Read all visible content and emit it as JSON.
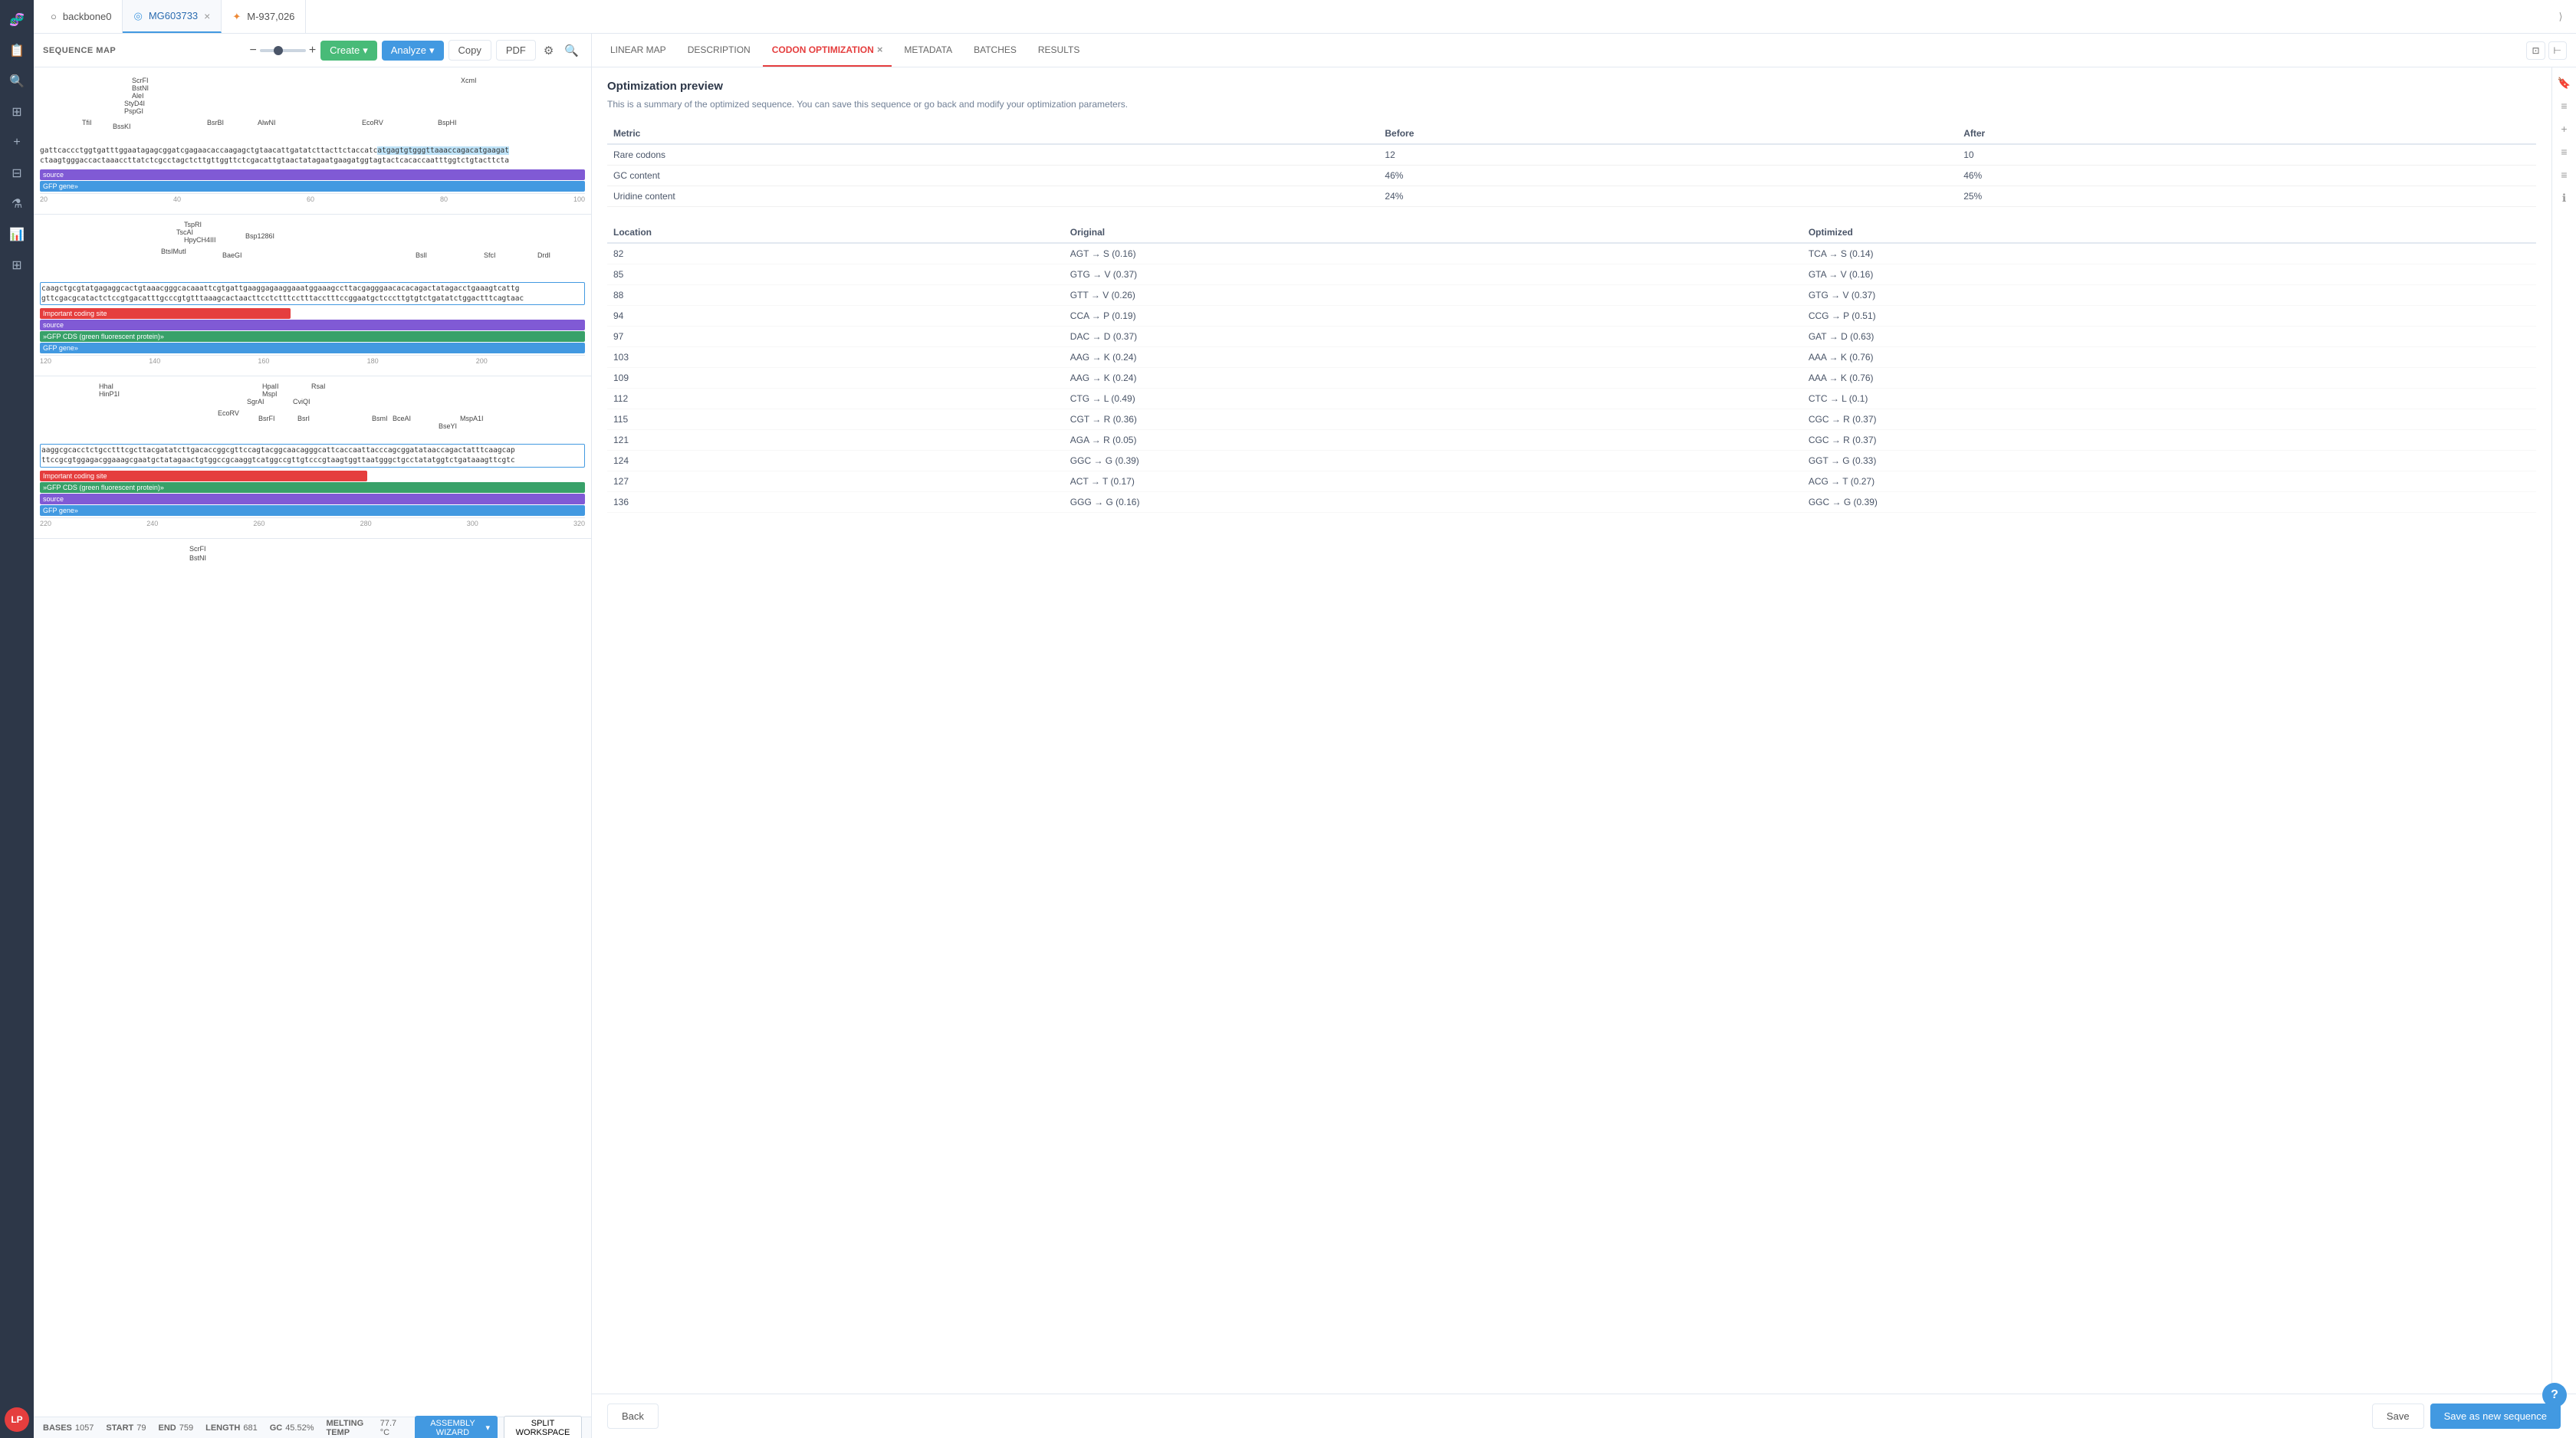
{
  "sidebar": {
    "icons": [
      {
        "name": "dna-icon",
        "symbol": "🧬",
        "active": false
      },
      {
        "name": "file-icon",
        "symbol": "📄",
        "active": false
      },
      {
        "name": "search-icon",
        "symbol": "🔍",
        "active": false
      },
      {
        "name": "layers-icon",
        "symbol": "⊞",
        "active": false
      },
      {
        "name": "plus-icon",
        "symbol": "+",
        "active": false
      },
      {
        "name": "table-icon",
        "symbol": "⊟",
        "active": false
      },
      {
        "name": "flask-icon",
        "symbol": "⚗",
        "active": false
      },
      {
        "name": "chart-icon",
        "symbol": "📊",
        "active": false
      },
      {
        "name": "grid-icon",
        "symbol": "⊞",
        "active": false
      }
    ],
    "avatar": "LP"
  },
  "tabs": [
    {
      "id": "backbone0",
      "label": "backbone0",
      "icon": "○",
      "active": false,
      "closeable": false
    },
    {
      "id": "MG603733",
      "label": "MG603733",
      "icon": "◎",
      "active": true,
      "closeable": true
    },
    {
      "id": "M-937026",
      "label": "M-937,026",
      "icon": "✦",
      "active": false,
      "closeable": false
    }
  ],
  "sequence_map": {
    "title": "SEQUENCE MAP",
    "toolbar": {
      "create_label": "Create",
      "analyze_label": "Analyze",
      "copy_label": "Copy",
      "pdf_label": "PDF"
    },
    "blocks": [
      {
        "id": "block1",
        "restriction_sites": [
          {
            "label": "ScrFI",
            "x": 13
          },
          {
            "label": "BstNI",
            "x": 13
          },
          {
            "label": "AleI",
            "x": 13
          },
          {
            "label": "StyD4I",
            "x": 13
          },
          {
            "label": "PspGI",
            "x": 13
          },
          {
            "label": "TfiI",
            "x": 0
          },
          {
            "label": "BssKI",
            "x": 10
          },
          {
            "label": "BsrBI",
            "x": 22
          },
          {
            "label": "AlwNI",
            "x": 29
          },
          {
            "label": "EcoRV",
            "x": 43
          },
          {
            "label": "BspHI",
            "x": 53
          },
          {
            "label": "XcmI",
            "x": 55
          }
        ],
        "seq1": "gattcaccctggtgatttggaatagagcggatcgagaacaccaagagctgtaacattgatatcttacttctaccatcatgagtgtgggttaaaccagacatgaagat",
        "seq2": "ctaagtgggaccactaaaccttatctcgcctagctcttgttggttctcgacattgtaactatagaatgaagatggtagtactcacaccaatttggtctgtacttcta",
        "features": [
          {
            "label": "source",
            "type": "source",
            "width": "100%"
          },
          {
            "label": "GFP gene",
            "type": "gfp",
            "width": "100%"
          }
        ],
        "ruler": [
          "20",
          "40",
          "60",
          "80",
          "100"
        ]
      },
      {
        "id": "block2",
        "restriction_sites": [
          {
            "label": "TspRI",
            "x": 19
          },
          {
            "label": "TscAI",
            "x": 18
          },
          {
            "label": "HpyCH4III",
            "x": 19
          },
          {
            "label": "Bsp1286I",
            "x": 27
          },
          {
            "label": "BtsIMutI",
            "x": 16
          },
          {
            "label": "BaeGI",
            "x": 24
          },
          {
            "label": "BslI",
            "x": 49
          },
          {
            "label": "SfcI",
            "x": 59
          },
          {
            "label": "DrdI",
            "x": 66
          }
        ],
        "seq1": "caagctgcgtatgagaggcactgtaaacgggcacaaattcgtgattgaaggagaaggaaatggaaagccttacgagggaacacacagactatagacctgaaagtcattg",
        "seq2": "gttcgacgcatactctccgtgacatttgcccgtgtttaaagcactaacttcctctttcctttacctttccggaatgctcccttgtgtctgatatctggactttcagtaac",
        "features": [
          {
            "label": "Important coding site",
            "type": "coding",
            "width": "45%"
          },
          {
            "label": "source",
            "type": "source",
            "width": "100%"
          },
          {
            "label": "GFP CDS (green fluorescent protein)",
            "type": "cds",
            "width": "100%"
          },
          {
            "label": "GFP gene",
            "type": "gfp",
            "width": "100%"
          }
        ],
        "ruler": [
          "120",
          "140",
          "160",
          "180",
          "200",
          ""
        ]
      },
      {
        "id": "block3",
        "restriction_sites": [
          {
            "label": "HhaI",
            "x": 8
          },
          {
            "label": "HinP1I",
            "x": 8
          },
          {
            "label": "HpaII",
            "x": 30
          },
          {
            "label": "MspI",
            "x": 30
          },
          {
            "label": "RsaI",
            "x": 36
          },
          {
            "label": "SgrAI",
            "x": 28
          },
          {
            "label": "CviQI",
            "x": 34
          },
          {
            "label": "EcoRV",
            "x": 24
          },
          {
            "label": "BsrFI",
            "x": 30
          },
          {
            "label": "BsrI",
            "x": 34
          },
          {
            "label": "BsmI",
            "x": 44
          },
          {
            "label": "BceAI",
            "x": 47
          },
          {
            "label": "MspA1I",
            "x": 56
          },
          {
            "label": "BseYI",
            "x": 53
          }
        ],
        "seq1": "aaggcgcacctctgcctttcgcttacgatatcttgacaccggcgttccagtacggcaacagggcattcaccaattacccagcggatataaccagactatttcaagcap",
        "seq2": "ttccgcgtggagacggaaagcgaatgctatagaactgtggccgcaaggtcatggccgttgtcccgtaagtggttaatgggctgcctatatggtctgataaagttcgtc",
        "features": [
          {
            "label": "Important coding site",
            "type": "coding",
            "width": "60%"
          },
          {
            "label": "GFP CDS (green fluorescent protein)",
            "type": "cds",
            "width": "100%"
          },
          {
            "label": "source",
            "type": "source",
            "width": "100%"
          },
          {
            "label": "GFP gene",
            "type": "gfp",
            "width": "100%"
          }
        ],
        "ruler": [
          "220",
          "240",
          "260",
          "280",
          "300",
          "320"
        ]
      }
    ]
  },
  "right_panel": {
    "tabs": [
      {
        "id": "linear-map",
        "label": "LINEAR MAP",
        "active": false
      },
      {
        "id": "description",
        "label": "DESCRIPTION",
        "active": false
      },
      {
        "id": "codon-opt",
        "label": "CODON OPTIMIZATION",
        "active": true
      },
      {
        "id": "metadata",
        "label": "METADATA",
        "active": false
      },
      {
        "id": "batches",
        "label": "BATCHES",
        "active": false
      },
      {
        "id": "results",
        "label": "RESULTS",
        "active": false
      }
    ],
    "optimization": {
      "title": "Optimization preview",
      "description": "This is a summary of the optimized sequence. You can save this sequence or go back and modify your optimization parameters.",
      "metrics": {
        "headers": [
          "Metric",
          "Before",
          "After"
        ],
        "rows": [
          {
            "metric": "Rare codons",
            "before": "12",
            "after": "10"
          },
          {
            "metric": "GC content",
            "before": "46%",
            "after": "46%"
          },
          {
            "metric": "Uridine content",
            "before": "24%",
            "after": "25%"
          }
        ]
      },
      "locations": {
        "headers": [
          "Location",
          "Original",
          "Optimized"
        ],
        "rows": [
          {
            "location": "82",
            "original": "AGT → S (0.16)",
            "optimized": "TCA → S (0.14)"
          },
          {
            "location": "85",
            "original": "GTG → V (0.37)",
            "optimized": "GTA → V (0.16)"
          },
          {
            "location": "88",
            "original": "GTT → V (0.26)",
            "optimized": "GTG → V (0.37)"
          },
          {
            "location": "94",
            "original": "CCA → P (0.19)",
            "optimized": "CCG → P (0.51)"
          },
          {
            "location": "97",
            "original": "DAC → D (0.37)",
            "optimized": "GAT → D (0.63)"
          },
          {
            "location": "103",
            "original": "AAG → K (0.24)",
            "optimized": "AAA → K (0.76)"
          },
          {
            "location": "109",
            "original": "AAG → K (0.24)",
            "optimized": "AAA → K (0.76)"
          },
          {
            "location": "112",
            "original": "CTG → L (0.49)",
            "optimized": "CTC → L (0.1)"
          },
          {
            "location": "115",
            "original": "CGT → R (0.36)",
            "optimized": "CGC → R (0.37)"
          },
          {
            "location": "121",
            "original": "AGA → R (0.05)",
            "optimized": "CGC → R (0.37)"
          },
          {
            "location": "124",
            "original": "GGC → G (0.39)",
            "optimized": "GGT → G (0.33)"
          },
          {
            "location": "127",
            "original": "ACT → T (0.17)",
            "optimized": "ACG → T (0.27)"
          },
          {
            "location": "136",
            "original": "GGG → G (0.16)",
            "optimized": "GGC → G (0.39)"
          }
        ]
      },
      "footer": {
        "back_label": "Back",
        "save_label": "Save",
        "save_new_label": "Save as new sequence"
      }
    }
  },
  "status_bar": {
    "bases_label": "BASES",
    "bases_value": "1057",
    "start_label": "START",
    "start_value": "79",
    "end_label": "END",
    "end_value": "759",
    "length_label": "LENGTH",
    "length_value": "681",
    "gc_label": "GC",
    "gc_value": "45.52%",
    "melting_label": "MELTING TEMP",
    "melting_value": "77.7 °C",
    "assembly_label": "ASSEMBLY WIZARD",
    "split_label": "SPLIT WORKSPACE"
  },
  "help_button": "?"
}
